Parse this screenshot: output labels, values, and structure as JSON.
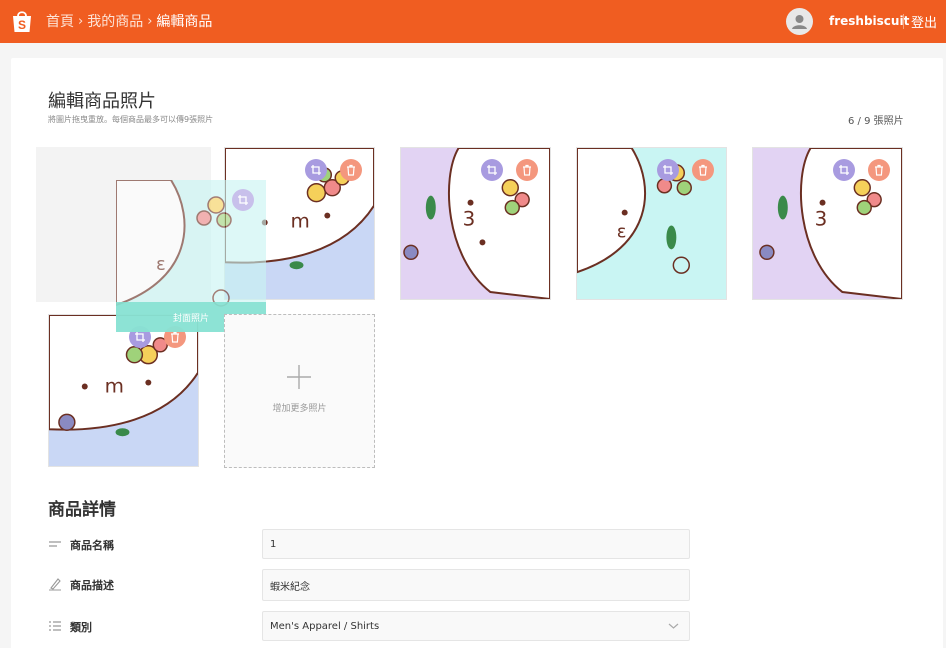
{
  "header": {
    "breadcrumbs": [
      "首頁",
      "我的商品",
      "編輯商品"
    ],
    "separator": "›",
    "username": "freshbiscuit",
    "logout": "登出"
  },
  "photos": {
    "title": "編輯商品照片",
    "subtitle": "將圖片拖曳重放。每個商品最多可以傳9張照片",
    "count": "6 / 9 張照片",
    "cover_label": "封面照片",
    "add_label": "增加更多照片",
    "items": [
      {
        "background": "blue",
        "mouth": "m"
      },
      {
        "background": "purple",
        "mouth": "3"
      },
      {
        "background": "cyan",
        "mouth": "ε"
      },
      {
        "background": "purple",
        "mouth": "3"
      },
      {
        "background": "blue",
        "mouth": "m"
      }
    ],
    "dragging": {
      "background": "cyan",
      "mouth": "ε"
    }
  },
  "details": {
    "title": "商品詳情",
    "fields": [
      {
        "icon": "text-lines-icon",
        "label": "商品名稱",
        "value": "1"
      },
      {
        "icon": "pencil-icon",
        "label": "商品描述",
        "value": "蝦米紀念"
      },
      {
        "icon": "list-icon",
        "label": "類別",
        "value": "Men's Apparel / Shirts"
      }
    ]
  },
  "colors": {
    "brand": "#f05d21",
    "crop_button": "#a89be0",
    "delete_button": "#f4977e",
    "cover_label": "#84e0d0",
    "bg_blue": "#c9d7f5",
    "bg_purple": "#e2d3f3",
    "bg_cyan": "#c9f5f3"
  }
}
